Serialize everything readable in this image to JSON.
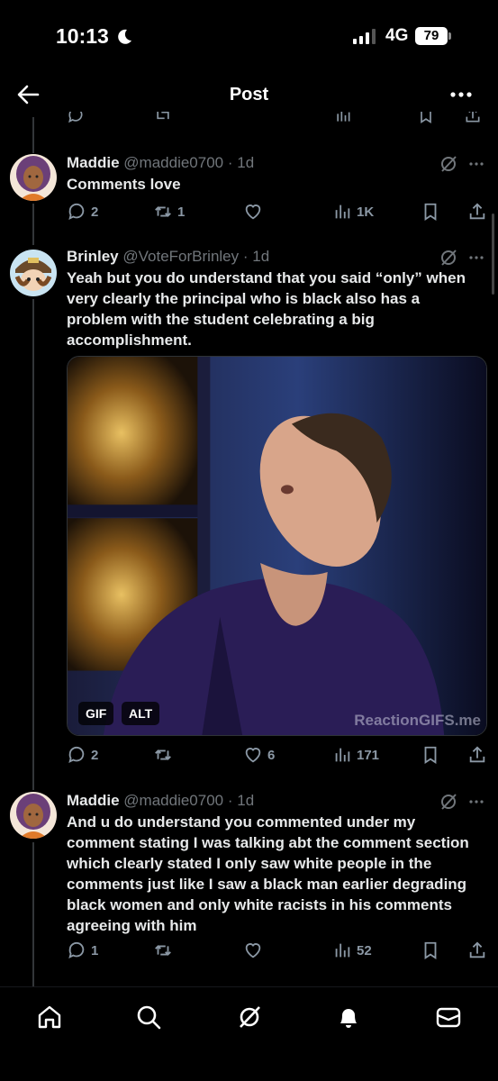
{
  "status_bar": {
    "time": "10:13",
    "network": "4G",
    "battery": "79"
  },
  "header": {
    "title": "Post"
  },
  "tweets": [
    {
      "name": "Maddie",
      "handle": "@maddie0700",
      "time": "· 1d",
      "text": "Comments love",
      "replies": "2",
      "retweets": "1",
      "likes": "",
      "views": "1K"
    },
    {
      "name": "Brinley",
      "handle": "@VoteForBrinley",
      "time": "· 1d",
      "text": "Yeah but you do understand that you said “only” when very clearly the principal who is black also has a problem with the student celebrating a big accomplishment.",
      "media": {
        "gif_label": "GIF",
        "alt_label": "ALT",
        "watermark": "ReactionGIFS.me"
      },
      "replies": "2",
      "retweets": "",
      "likes": "6",
      "views": "171"
    },
    {
      "name": "Maddie",
      "handle": "@maddie0700",
      "time": "· 1d",
      "text": "And u do understand you commented under my comment stating I was talking abt the comment section which clearly stated I only saw white people in the comments just like I saw a black man earlier degrading black women and only white racists in his comments agreeing with him",
      "replies": "1",
      "retweets": "",
      "likes": "",
      "views": "52"
    }
  ],
  "icons": {
    "reply": "reply-icon",
    "retweet": "retweet-icon",
    "like": "like-icon",
    "views": "views-icon",
    "bookmark": "bookmark-icon",
    "share": "share-icon",
    "grok": "grok-icon",
    "more": "more-icon"
  },
  "bottom_nav": [
    "home-icon",
    "search-icon",
    "grok-icon",
    "notifications-icon",
    "messages-icon"
  ],
  "colors": {
    "background": "#000000",
    "text": "#e7e9ea",
    "muted": "#71767b",
    "action": "#8b98a5"
  }
}
